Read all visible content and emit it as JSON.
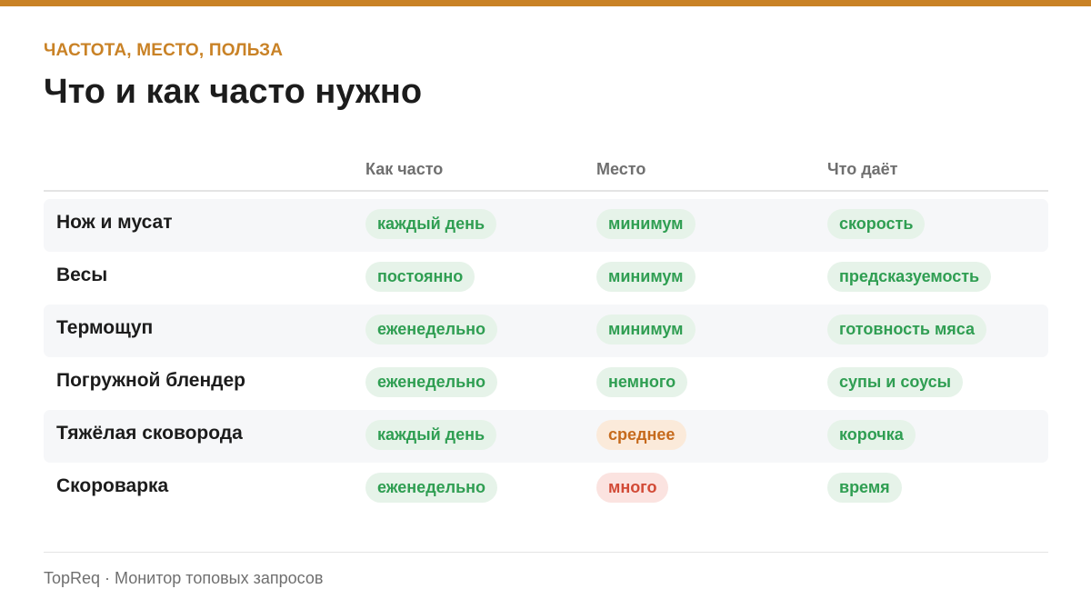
{
  "colors": {
    "accent": "#c98226",
    "level_low_bg": "#e6f3e9",
    "level_low_text": "#2f9e52",
    "level_mid_bg": "#fbeada",
    "level_mid_text": "#c66a1c",
    "level_high_bg": "#fbe3e0",
    "level_high_text": "#d24a36"
  },
  "header": {
    "kicker": "ЧАСТОТА, МЕСТО, ПОЛЬЗА",
    "title": "Что и как часто нужно"
  },
  "table": {
    "columns": [
      "Как часто",
      "Место",
      "Что даёт"
    ],
    "rows": [
      {
        "name": "Нож и мусат",
        "frequency": "каждый день",
        "space": "минимум",
        "space_level": "low",
        "benefit": "скорость"
      },
      {
        "name": "Весы",
        "frequency": "постоянно",
        "space": "минимум",
        "space_level": "low",
        "benefit": "предсказуемость"
      },
      {
        "name": "Термощуп",
        "frequency": "еженедельно",
        "space": "минимум",
        "space_level": "low",
        "benefit": "готовность мяса"
      },
      {
        "name": "Погружной блендер",
        "frequency": "еженедельно",
        "space": "немного",
        "space_level": "low",
        "benefit": "супы и соусы"
      },
      {
        "name": "Тяжёлая сковорода",
        "frequency": "каждый день",
        "space": "среднее",
        "space_level": "mid",
        "benefit": "корочка"
      },
      {
        "name": "Скороварка",
        "frequency": "еженедельно",
        "space": "много",
        "space_level": "high",
        "benefit": "время"
      }
    ]
  },
  "footer": {
    "text": "TopReq · Монитор топовых запросов"
  }
}
